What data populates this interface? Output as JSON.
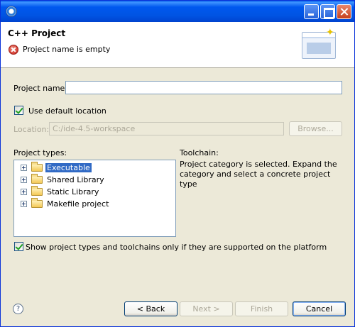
{
  "window": {
    "title": "",
    "header_title": "C++ Project",
    "error_message": "Project name is empty"
  },
  "form": {
    "project_name_label": "Project name:",
    "project_name_value": "",
    "use_default_location_label": "Use default location",
    "use_default_location_checked": true,
    "location_label": "Location:",
    "location_value": "C:/ide-4.5-workspace",
    "browse_label": "Browse...",
    "project_types_label": "Project types:",
    "toolchain_label": "Toolchain:",
    "toolchain_message": "Project category is selected. Expand the category and select a concrete project type",
    "show_supported_label": "Show project types and toolchains only if they are supported on the platform",
    "show_supported_checked": true
  },
  "project_types": [
    {
      "label": "Executable",
      "selected": true
    },
    {
      "label": "Shared Library",
      "selected": false
    },
    {
      "label": "Static Library",
      "selected": false
    },
    {
      "label": "Makefile project",
      "selected": false
    }
  ],
  "buttons": {
    "back": "< Back",
    "next": "Next >",
    "finish": "Finish",
    "cancel": "Cancel"
  },
  "icons": {
    "app": "eclipse-icon",
    "error": "error-icon",
    "help": "help-icon",
    "folder": "folder-icon",
    "expander": "plus-box-icon"
  },
  "colors": {
    "titlebar": "#0054e3",
    "selection": "#316ac5",
    "dialog_bg": "#ece9d8"
  }
}
